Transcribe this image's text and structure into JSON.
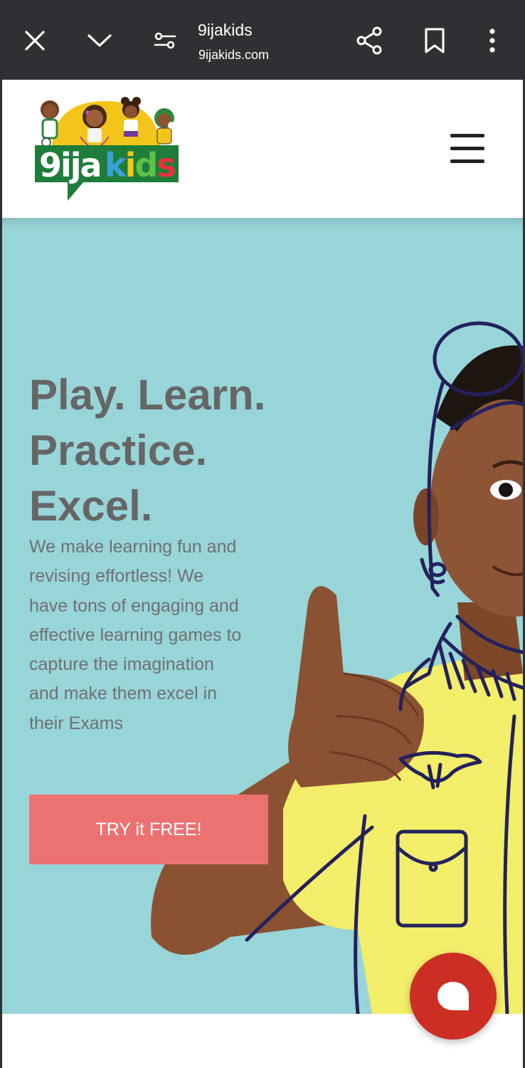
{
  "browser": {
    "title": "9ijakids",
    "url": "9ijakids.com",
    "icons": [
      "close-icon",
      "chevron-down-icon",
      "tune-icon",
      "share-icon",
      "bookmark-icon",
      "more-vert-icon"
    ]
  },
  "header": {
    "logo_text": "9ijakids",
    "menu_icon": "hamburger-icon"
  },
  "hero": {
    "headline_lines": [
      "Play. Learn.",
      "Practice.",
      "Excel."
    ],
    "body": "We make learning fun and revising effortless! We have tons of engaging and effective learning games to capture the imagination and make them excel in their Exams",
    "cta_label": "TRY it FREE!"
  },
  "chat": {
    "icon": "chat-bubble-icon"
  },
  "colors": {
    "browser_bar": "#2f3033",
    "hero_bg": "#98d5d8",
    "headline": "#666666",
    "cta_bg": "#ec7272",
    "chat_fab": "#cc2e24",
    "logo_green": "#1e7d3a",
    "logo_yellow": "#f3c51b"
  }
}
